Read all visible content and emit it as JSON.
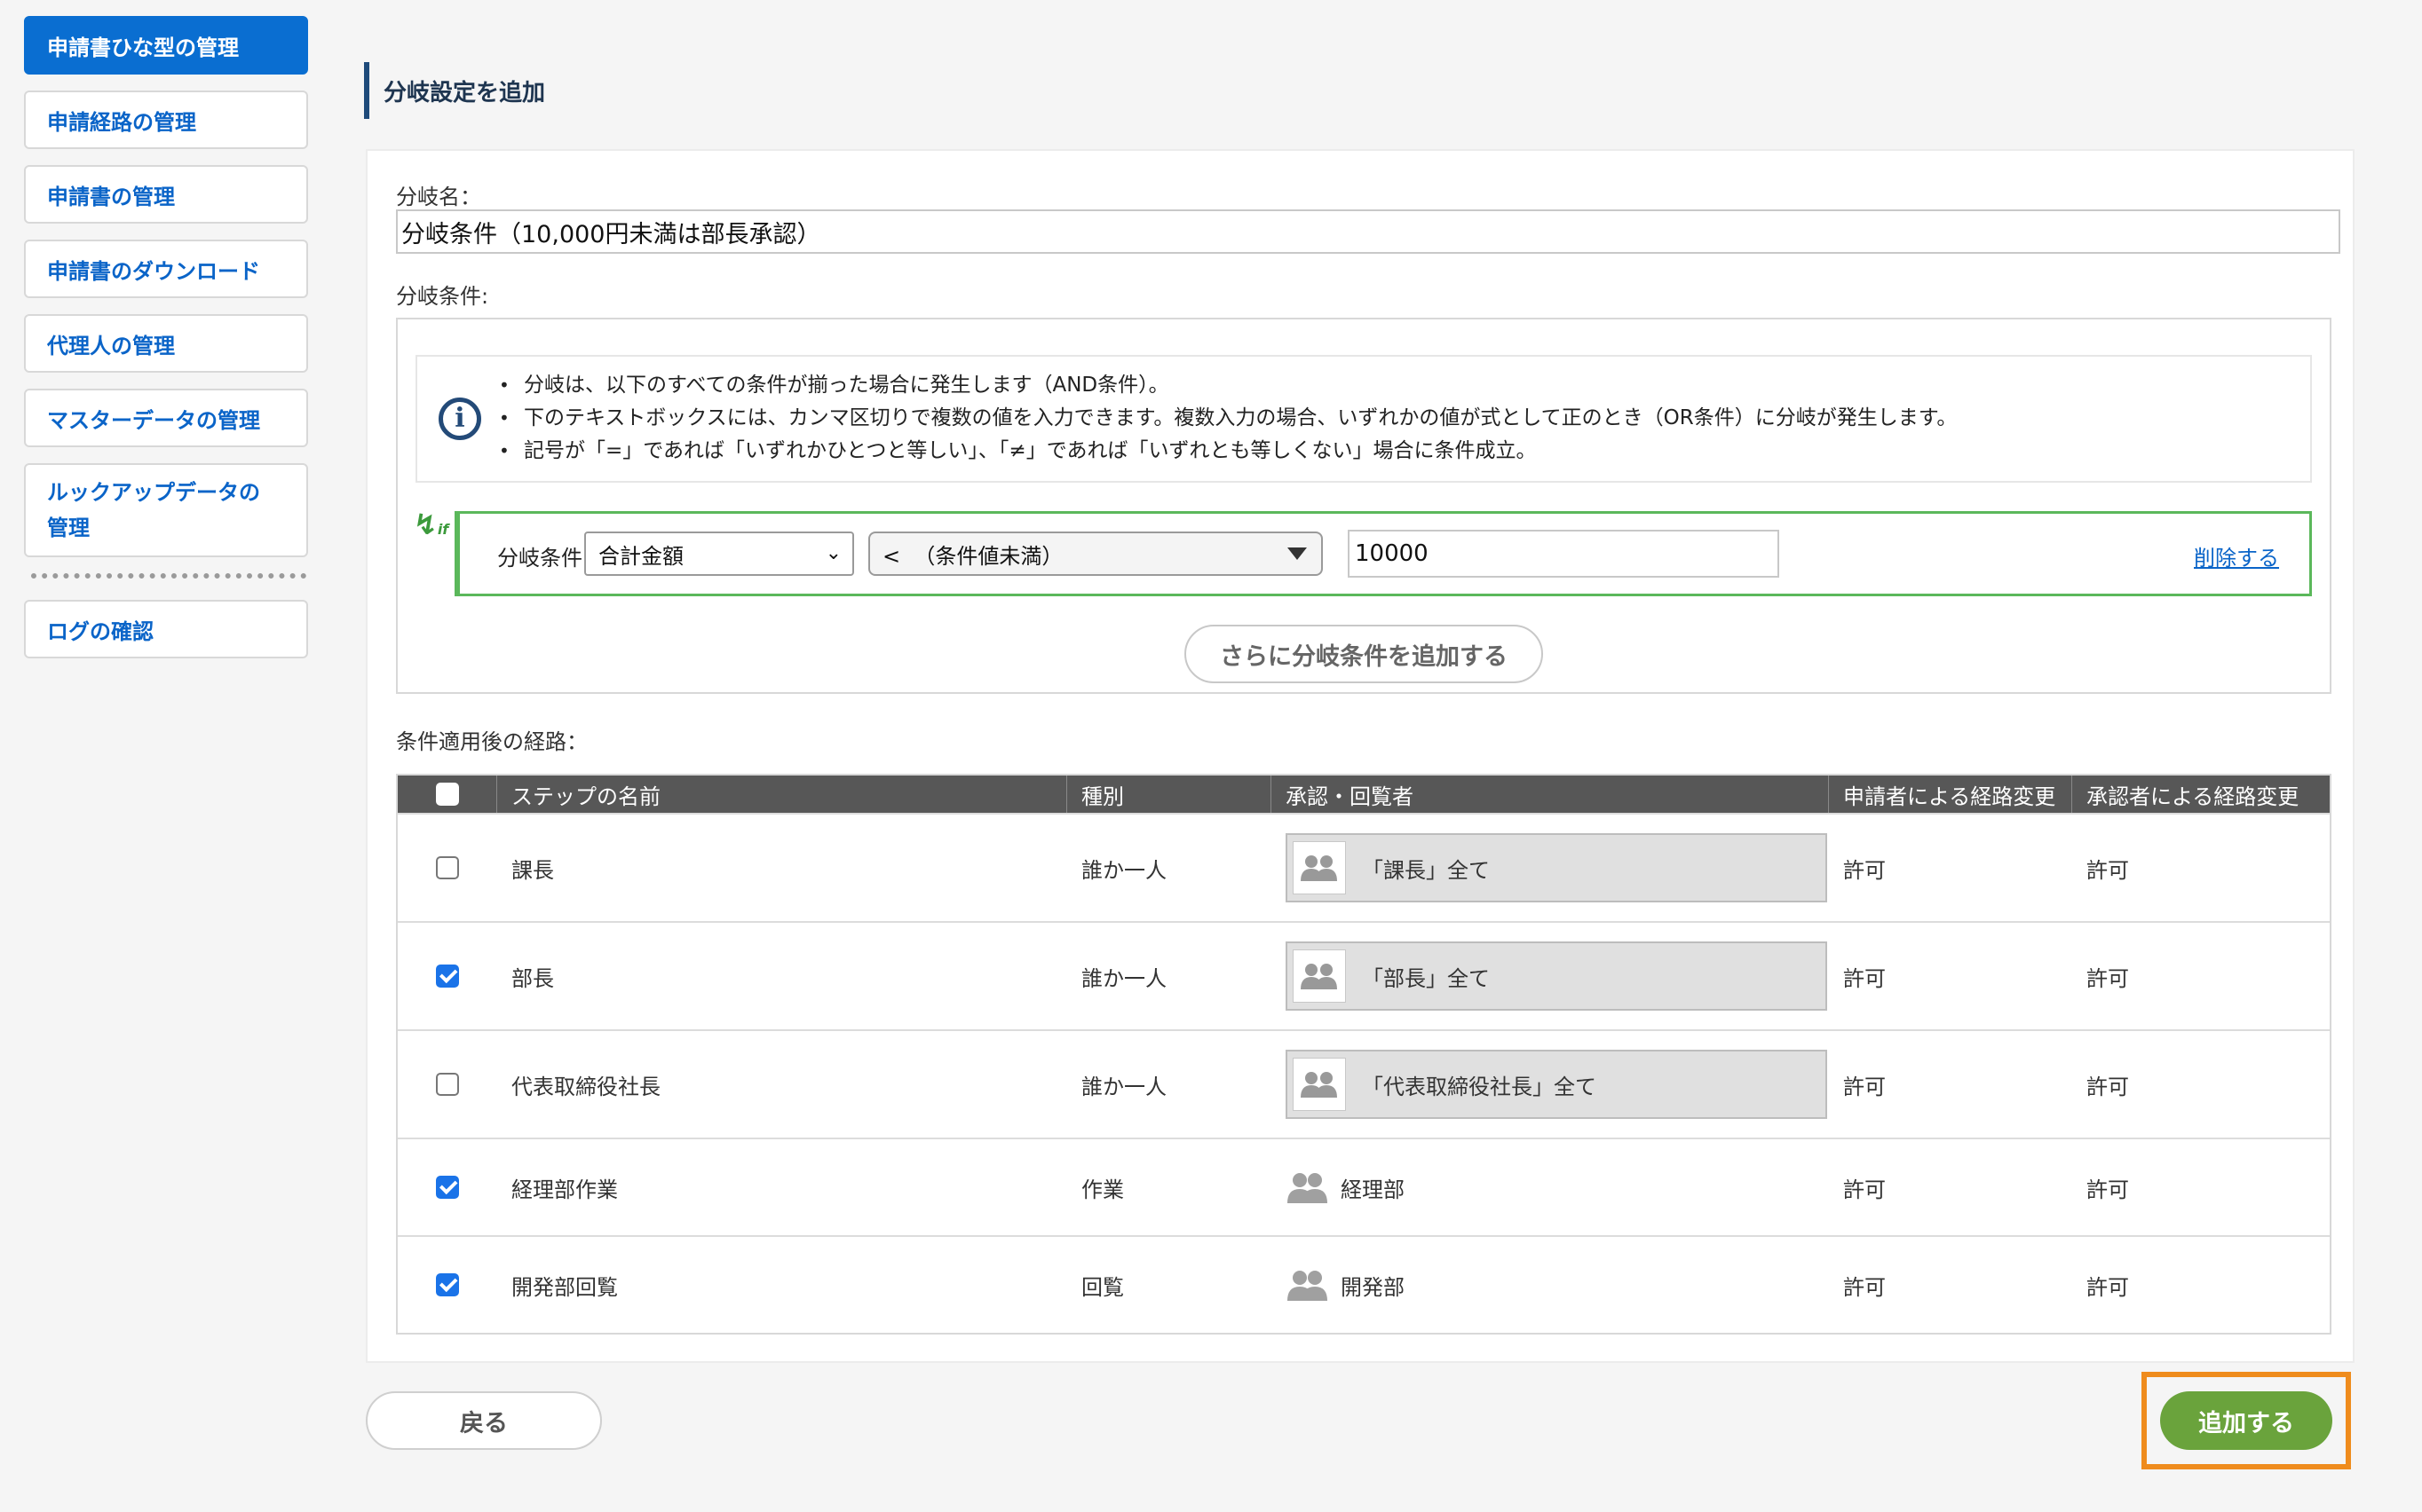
{
  "sidebar": {
    "items": [
      {
        "label": "申請書ひな型の管理",
        "active": true
      },
      {
        "label": "申請経路の管理"
      },
      {
        "label": "申請書の管理"
      },
      {
        "label": "申請書のダウンロード"
      },
      {
        "label": "代理人の管理"
      },
      {
        "label": "マスターデータの管理"
      },
      {
        "label": "ルックアップデータの管理"
      },
      {
        "label": "ログの確認"
      }
    ]
  },
  "page": {
    "title": "分岐設定を追加"
  },
  "form": {
    "branch_name_label": "分岐名：",
    "branch_name_value": "分岐条件（10,000円未満は部長承認）",
    "branch_condition_label": "分岐条件:",
    "info": {
      "icon": "info-icon",
      "lines": [
        "分岐は、以下のすべての条件が揃った場合に発生します（AND条件）。",
        "下のテキストボックスには、カンマ区切りで複数の値を入力できます。複数入力の場合、いずれかの値が式として正のとき（OR条件）に分岐が発生します。",
        "記号が「=」であれば「いずれかひとつと等しい」、「≠」であれば「いずれとも等しくない」場合に条件成立。"
      ]
    },
    "condition": {
      "label": "分岐条件",
      "field_selected": "合計金額",
      "operator_selected": "<  （条件値未満）",
      "value": "10000",
      "delete_label": "削除する"
    },
    "add_condition_label": "さらに分岐条件を追加する",
    "route_label": "条件適用後の経路："
  },
  "route_table": {
    "headers": {
      "name": "ステップの名前",
      "type": "種別",
      "approvers": "承認・回覧者",
      "applicant_change": "申請者による経路変更",
      "approver_change": "承認者による経路変更"
    },
    "rows": [
      {
        "checked": false,
        "name": "課長",
        "type": "誰か一人",
        "approver": "「課長」全て",
        "approver_style": "box",
        "applicant_change": "許可",
        "approver_change": "許可"
      },
      {
        "checked": true,
        "name": "部長",
        "type": "誰か一人",
        "approver": "「部長」全て",
        "approver_style": "box",
        "applicant_change": "許可",
        "approver_change": "許可"
      },
      {
        "checked": false,
        "name": "代表取締役社長",
        "type": "誰か一人",
        "approver": "「代表取締役社長」全て",
        "approver_style": "box",
        "applicant_change": "許可",
        "approver_change": "許可"
      },
      {
        "checked": true,
        "name": "経理部作業",
        "type": "作業",
        "approver": "経理部",
        "approver_style": "inline",
        "applicant_change": "許可",
        "approver_change": "許可"
      },
      {
        "checked": true,
        "name": "開発部回覧",
        "type": "回覧",
        "approver": "開発部",
        "approver_style": "inline",
        "applicant_change": "許可",
        "approver_change": "許可"
      }
    ]
  },
  "buttons": {
    "back": "戻る",
    "submit": "追加する"
  },
  "colors": {
    "accent_blue": "#0a6ed1",
    "link_blue": "#0a64c8",
    "condition_green": "#5bb85b",
    "submit_green": "#6aa33c",
    "highlight_orange": "#ef8c1d",
    "table_header": "#575757"
  }
}
